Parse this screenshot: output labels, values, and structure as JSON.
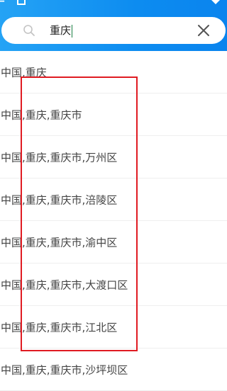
{
  "search": {
    "value": "重庆"
  },
  "results": [
    "中国,重庆",
    "中国,重庆,重庆市",
    "中国,重庆,重庆市,万州区",
    "中国,重庆,重庆市,涪陵区",
    "中国,重庆,重庆市,渝中区",
    "中国,重庆,重庆市,大渡口区",
    "中国,重庆,重庆市,江北区",
    "中国,重庆,重庆市,沙坪坝区"
  ],
  "colors": {
    "topbar": "#0d8cf0",
    "highlight_border": "#e01b22"
  },
  "icons": [
    "search-icon",
    "clear-icon"
  ]
}
